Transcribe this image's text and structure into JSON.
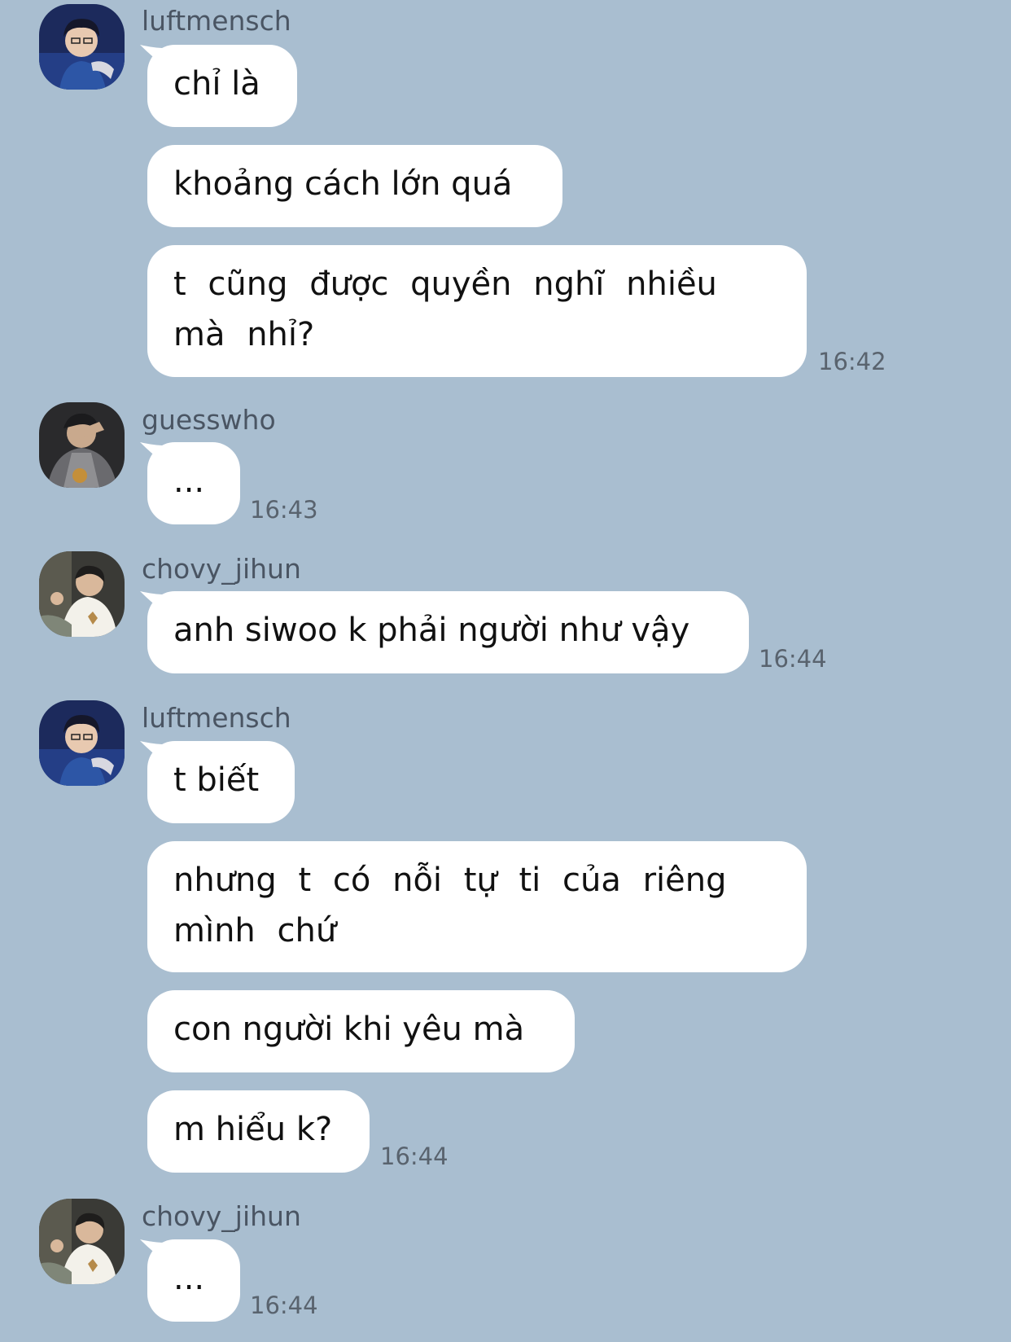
{
  "messages": [
    {
      "sender": "luftmensch",
      "avatar": "avatar-luftmensch",
      "bubbles": [
        "chỉ là",
        "khoảng cách lớn quá",
        "t cũng được quyền nghĩ nhiều mà nhỉ?"
      ],
      "time": "16:42"
    },
    {
      "sender": "guesswho",
      "avatar": "avatar-guesswho",
      "bubbles": [
        "..."
      ],
      "time": "16:43"
    },
    {
      "sender": "chovy_jihun",
      "avatar": "avatar-chovy",
      "bubbles": [
        "anh siwoo k phải người như vậy"
      ],
      "time": "16:44"
    },
    {
      "sender": "luftmensch",
      "avatar": "avatar-luftmensch",
      "bubbles": [
        "t biết",
        "nhưng t có nỗi tự ti của riêng mình chứ",
        "con người khi yêu mà",
        "m hiểu k?"
      ],
      "time": "16:44"
    },
    {
      "sender": "chovy_jihun",
      "avatar": "avatar-chovy",
      "bubbles": [
        "..."
      ],
      "time": "16:44"
    }
  ],
  "colors": {
    "background": "#a9bed0",
    "bubble": "#ffffff",
    "name": "#4a5563",
    "time": "#59636e"
  }
}
